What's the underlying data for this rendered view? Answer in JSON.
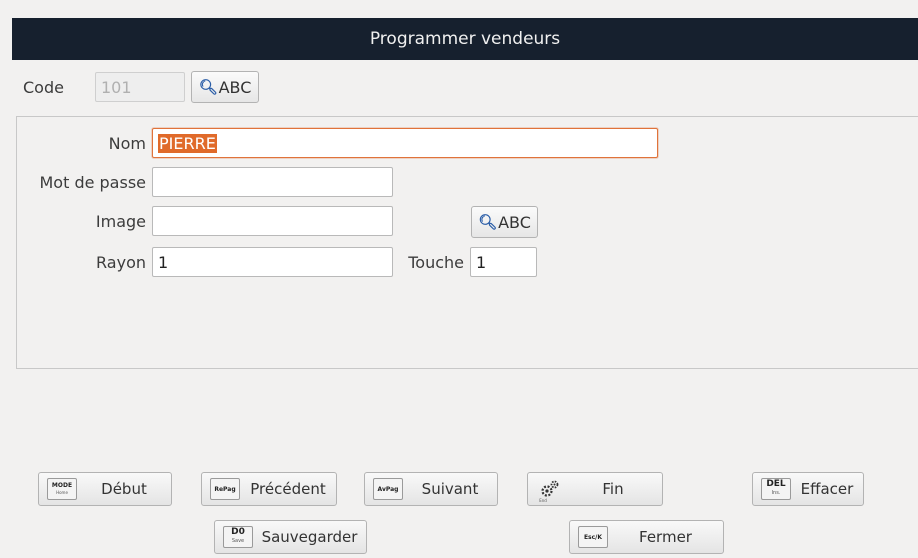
{
  "window": {
    "title": "Programmer vendeurs"
  },
  "header": {
    "code_label": "Code",
    "code_value": "101",
    "search_label": "ABC"
  },
  "form": {
    "nom_label": "Nom",
    "nom_value": "PIERRE",
    "password_label": "Mot de passe",
    "password_value": "",
    "image_label": "Image",
    "image_value": "",
    "image_search_label": "ABC",
    "rayon_label": "Rayon",
    "rayon_value": "1",
    "touche_label": "Touche",
    "touche_value": "1"
  },
  "buttons": {
    "debut": {
      "label": "Début",
      "key": "MODE",
      "key_sub": "Home"
    },
    "precedent": {
      "label": "Précédent",
      "key": "RePag"
    },
    "suivant": {
      "label": "Suivant",
      "key": "AvPag"
    },
    "fin": {
      "label": "Fin",
      "key_sub": "End"
    },
    "effacer": {
      "label": "Effacer",
      "key": "DEL",
      "key_sub": "Ins."
    },
    "sauvegarder": {
      "label": "Sauvegarder",
      "key": "D0",
      "key_sub": "Save"
    },
    "fermer": {
      "label": "Fermer",
      "key": "Esc/K"
    }
  },
  "colors": {
    "titlebar": "#16202e",
    "focus": "#e0733a",
    "selection": "#e06a2a",
    "search_icon": "#2b5ea8"
  }
}
